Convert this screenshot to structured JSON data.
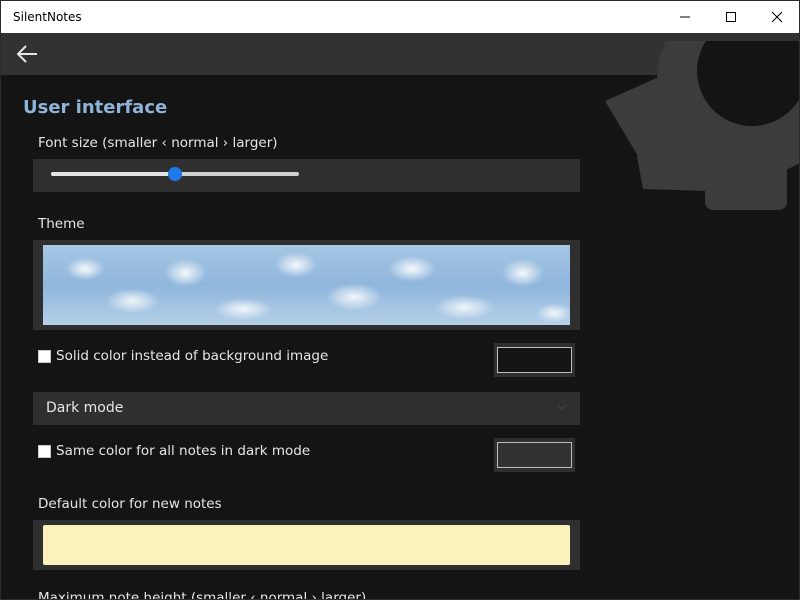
{
  "window": {
    "title": "SilentNotes"
  },
  "section": {
    "title": "User interface"
  },
  "font_size": {
    "label": "Font size (smaller ‹ normal › larger)",
    "value_fraction": 0.5
  },
  "theme": {
    "label": "Theme"
  },
  "solid_color": {
    "label": "Solid color instead of background image",
    "checked": false,
    "color": "#141414"
  },
  "dark_mode": {
    "selected": "Dark mode"
  },
  "same_color": {
    "label": "Same color for all notes in dark mode",
    "checked": false,
    "color": "#323232"
  },
  "default_color": {
    "label": "Default color for new notes",
    "color": "#fbf2bb"
  },
  "max_height": {
    "label": "Maximum note height (smaller ‹ normal › larger)"
  },
  "colors": {
    "accent": "#1e7ae8",
    "section_title": "#8fb4d8",
    "appbar": "#323232",
    "background": "#141414"
  }
}
